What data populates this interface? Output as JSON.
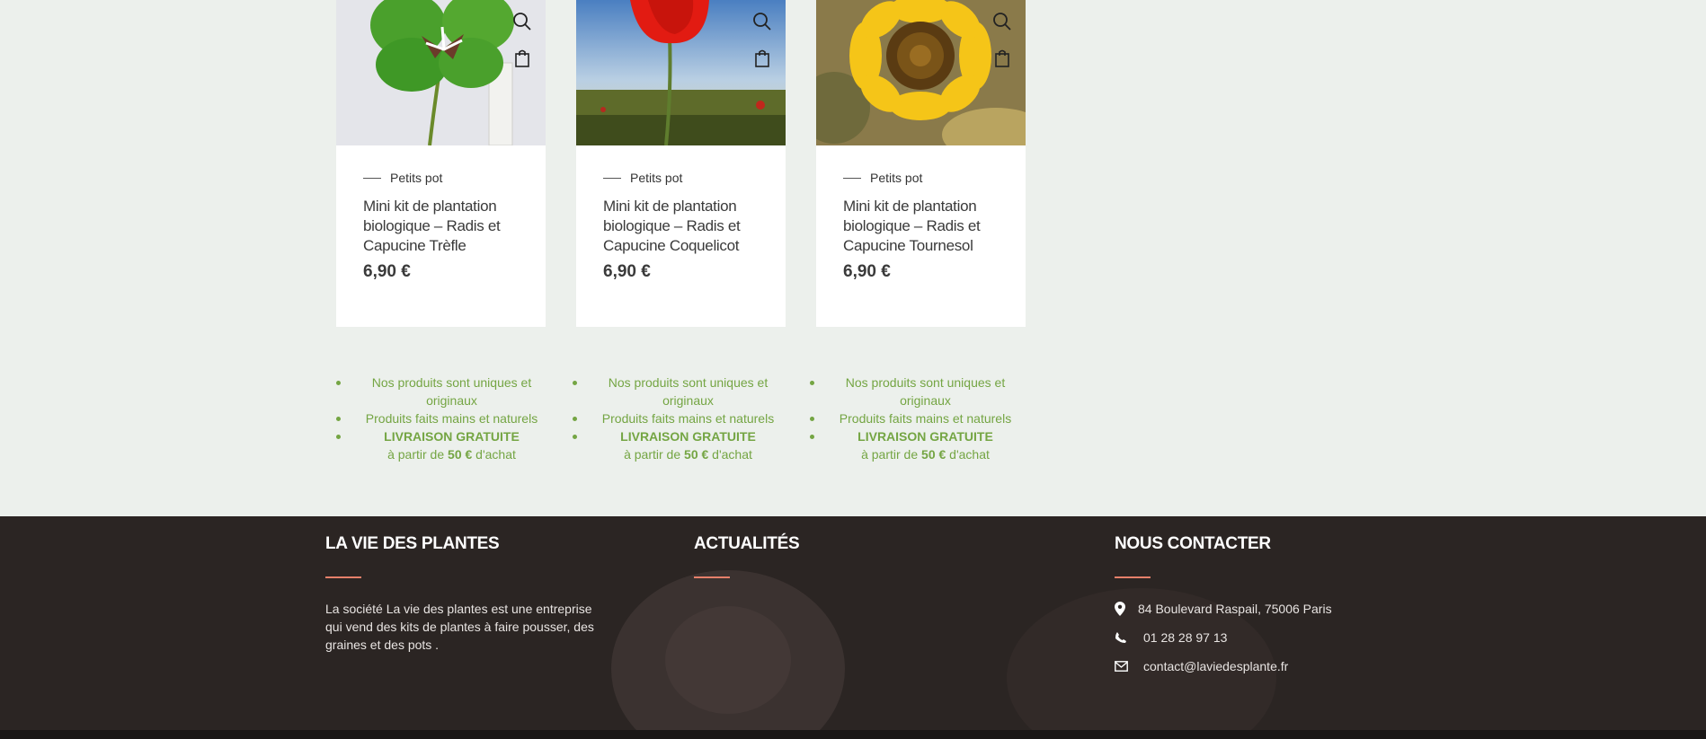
{
  "products": [
    {
      "category": "Petits pot",
      "title": "Mini kit de plantation biologique – Radis et Capucine Trèfle",
      "price": "6,90 €",
      "image": "clover"
    },
    {
      "category": "Petits pot",
      "title": "Mini kit de plantation biologique – Radis et Capucine Coquelicot",
      "price": "6,90 €",
      "image": "poppy"
    },
    {
      "category": "Petits pot",
      "title": "Mini kit de plantation biologique – Radis et Capucine Tournesol",
      "price": "6,90 €",
      "image": "sunflower"
    }
  ],
  "features": {
    "unique": "Nos produits sont uniques et originaux",
    "handmade": "Produits faits mains et naturels",
    "free_shipping": "LIVRAISON GRATUITE",
    "from_prefix": "à partir de",
    "threshold": "50 €",
    "from_suffix": "d'achat"
  },
  "footer": {
    "about": {
      "title": "LA VIE DES PLANTES",
      "text": "La société La vie des plantes est une entreprise qui vend des kits de plantes à faire pousser, des graines et des pots ."
    },
    "news": {
      "title": "ACTUALITÉS"
    },
    "contact": {
      "title": "NOUS CONTACTER",
      "address": "84 Boulevard Raspail, 75006 Paris",
      "phone": "01 28 28 97 13",
      "email": "contact@laviedesplante.fr"
    }
  },
  "icons": {
    "quickview": "search-icon",
    "cart": "shopping-bag-icon",
    "address": "map-pin-icon",
    "phone": "phone-icon",
    "email": "envelope-icon"
  },
  "colors": {
    "background": "#ecf0ec",
    "accent_green": "#74a543",
    "footer_bg": "#2b2523",
    "footer_rule": "#e6806a"
  }
}
